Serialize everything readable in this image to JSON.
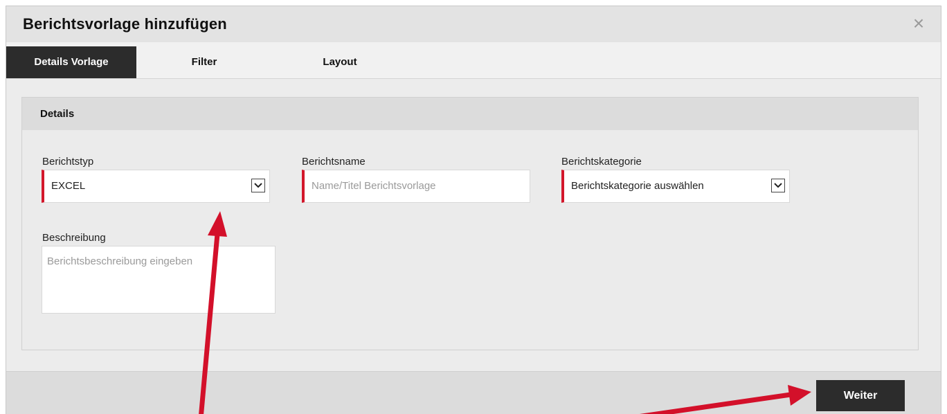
{
  "dialog": {
    "title": "Berichtsvorlage hinzufügen",
    "close_glyph": "×"
  },
  "tabs": [
    {
      "label": "Details Vorlage",
      "active": true
    },
    {
      "label": "Filter",
      "active": false
    },
    {
      "label": "Layout",
      "active": false
    }
  ],
  "details": {
    "section_title": "Details",
    "berichtstyp": {
      "label": "Berichtstyp",
      "value": "EXCEL"
    },
    "berichtsname": {
      "label": "Berichtsname",
      "placeholder": "Name/Titel Berichtsvorlage"
    },
    "berichtskategorie": {
      "label": "Berichtskategorie",
      "placeholder": "Berichtskategorie auswählen"
    },
    "beschreibung": {
      "label": "Beschreibung",
      "placeholder": "Berichtsbeschreibung eingeben"
    }
  },
  "footer": {
    "next_label": "Weiter"
  },
  "colors": {
    "accent_required": "#d3172b",
    "annotation_arrow": "#d3102a",
    "dark_button": "#2c2c2c"
  },
  "icons": {
    "close": "close-icon",
    "dropdown": "chevron-down-icon"
  }
}
